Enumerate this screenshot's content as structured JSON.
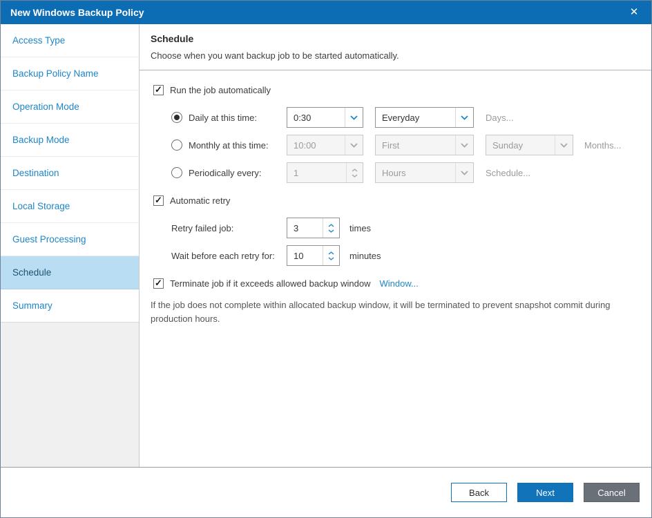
{
  "window": {
    "title": "New Windows Backup Policy",
    "close_label": "✕"
  },
  "sidebar": {
    "items": [
      {
        "label": "Access Type",
        "selected": false
      },
      {
        "label": "Backup Policy Name",
        "selected": false
      },
      {
        "label": "Operation Mode",
        "selected": false
      },
      {
        "label": "Backup Mode",
        "selected": false
      },
      {
        "label": "Destination",
        "selected": false
      },
      {
        "label": "Local Storage",
        "selected": false
      },
      {
        "label": "Guest Processing",
        "selected": false
      },
      {
        "label": "Schedule",
        "selected": true
      },
      {
        "label": "Summary",
        "selected": false
      }
    ]
  },
  "header": {
    "title": "Schedule",
    "subtitle": "Choose when you want backup job to be started automatically."
  },
  "schedule": {
    "run_automatically": {
      "label": "Run the job automatically",
      "checked": true
    },
    "daily": {
      "label": "Daily at this time:",
      "selected": true,
      "time_value": "0:30",
      "frequency_value": "Everyday",
      "days_link": "Days...",
      "days_enabled": false
    },
    "monthly": {
      "label": "Monthly at this time:",
      "selected": false,
      "time_value": "10:00",
      "week_value": "First",
      "weekday_value": "Sunday",
      "months_link": "Months...",
      "months_enabled": false
    },
    "periodically": {
      "label": "Periodically every:",
      "selected": false,
      "interval_value": "1",
      "unit_value": "Hours",
      "schedule_link": "Schedule...",
      "schedule_enabled": false
    },
    "automatic_retry": {
      "label": "Automatic retry",
      "checked": true
    },
    "retry_failed": {
      "label": "Retry failed job:",
      "value": "3",
      "suffix": "times"
    },
    "wait_retry": {
      "label": "Wait before each retry for:",
      "value": "10",
      "suffix": "minutes"
    },
    "terminate": {
      "label": "Terminate job if it exceeds allowed backup window",
      "checked": true,
      "window_link": "Window...",
      "note": "If the job does not complete within allocated backup window, it will be terminated to prevent snapshot commit during production hours."
    }
  },
  "footer": {
    "back_label": "Back",
    "next_label": "Next",
    "cancel_label": "Cancel"
  },
  "colors": {
    "titlebar_blue": "#0c6cb4",
    "accent_blue": "#1e87c6",
    "selected_item_bg": "#b9ddf2",
    "next_button_blue": "#1173ba",
    "cancel_button_gray": "#697078"
  }
}
